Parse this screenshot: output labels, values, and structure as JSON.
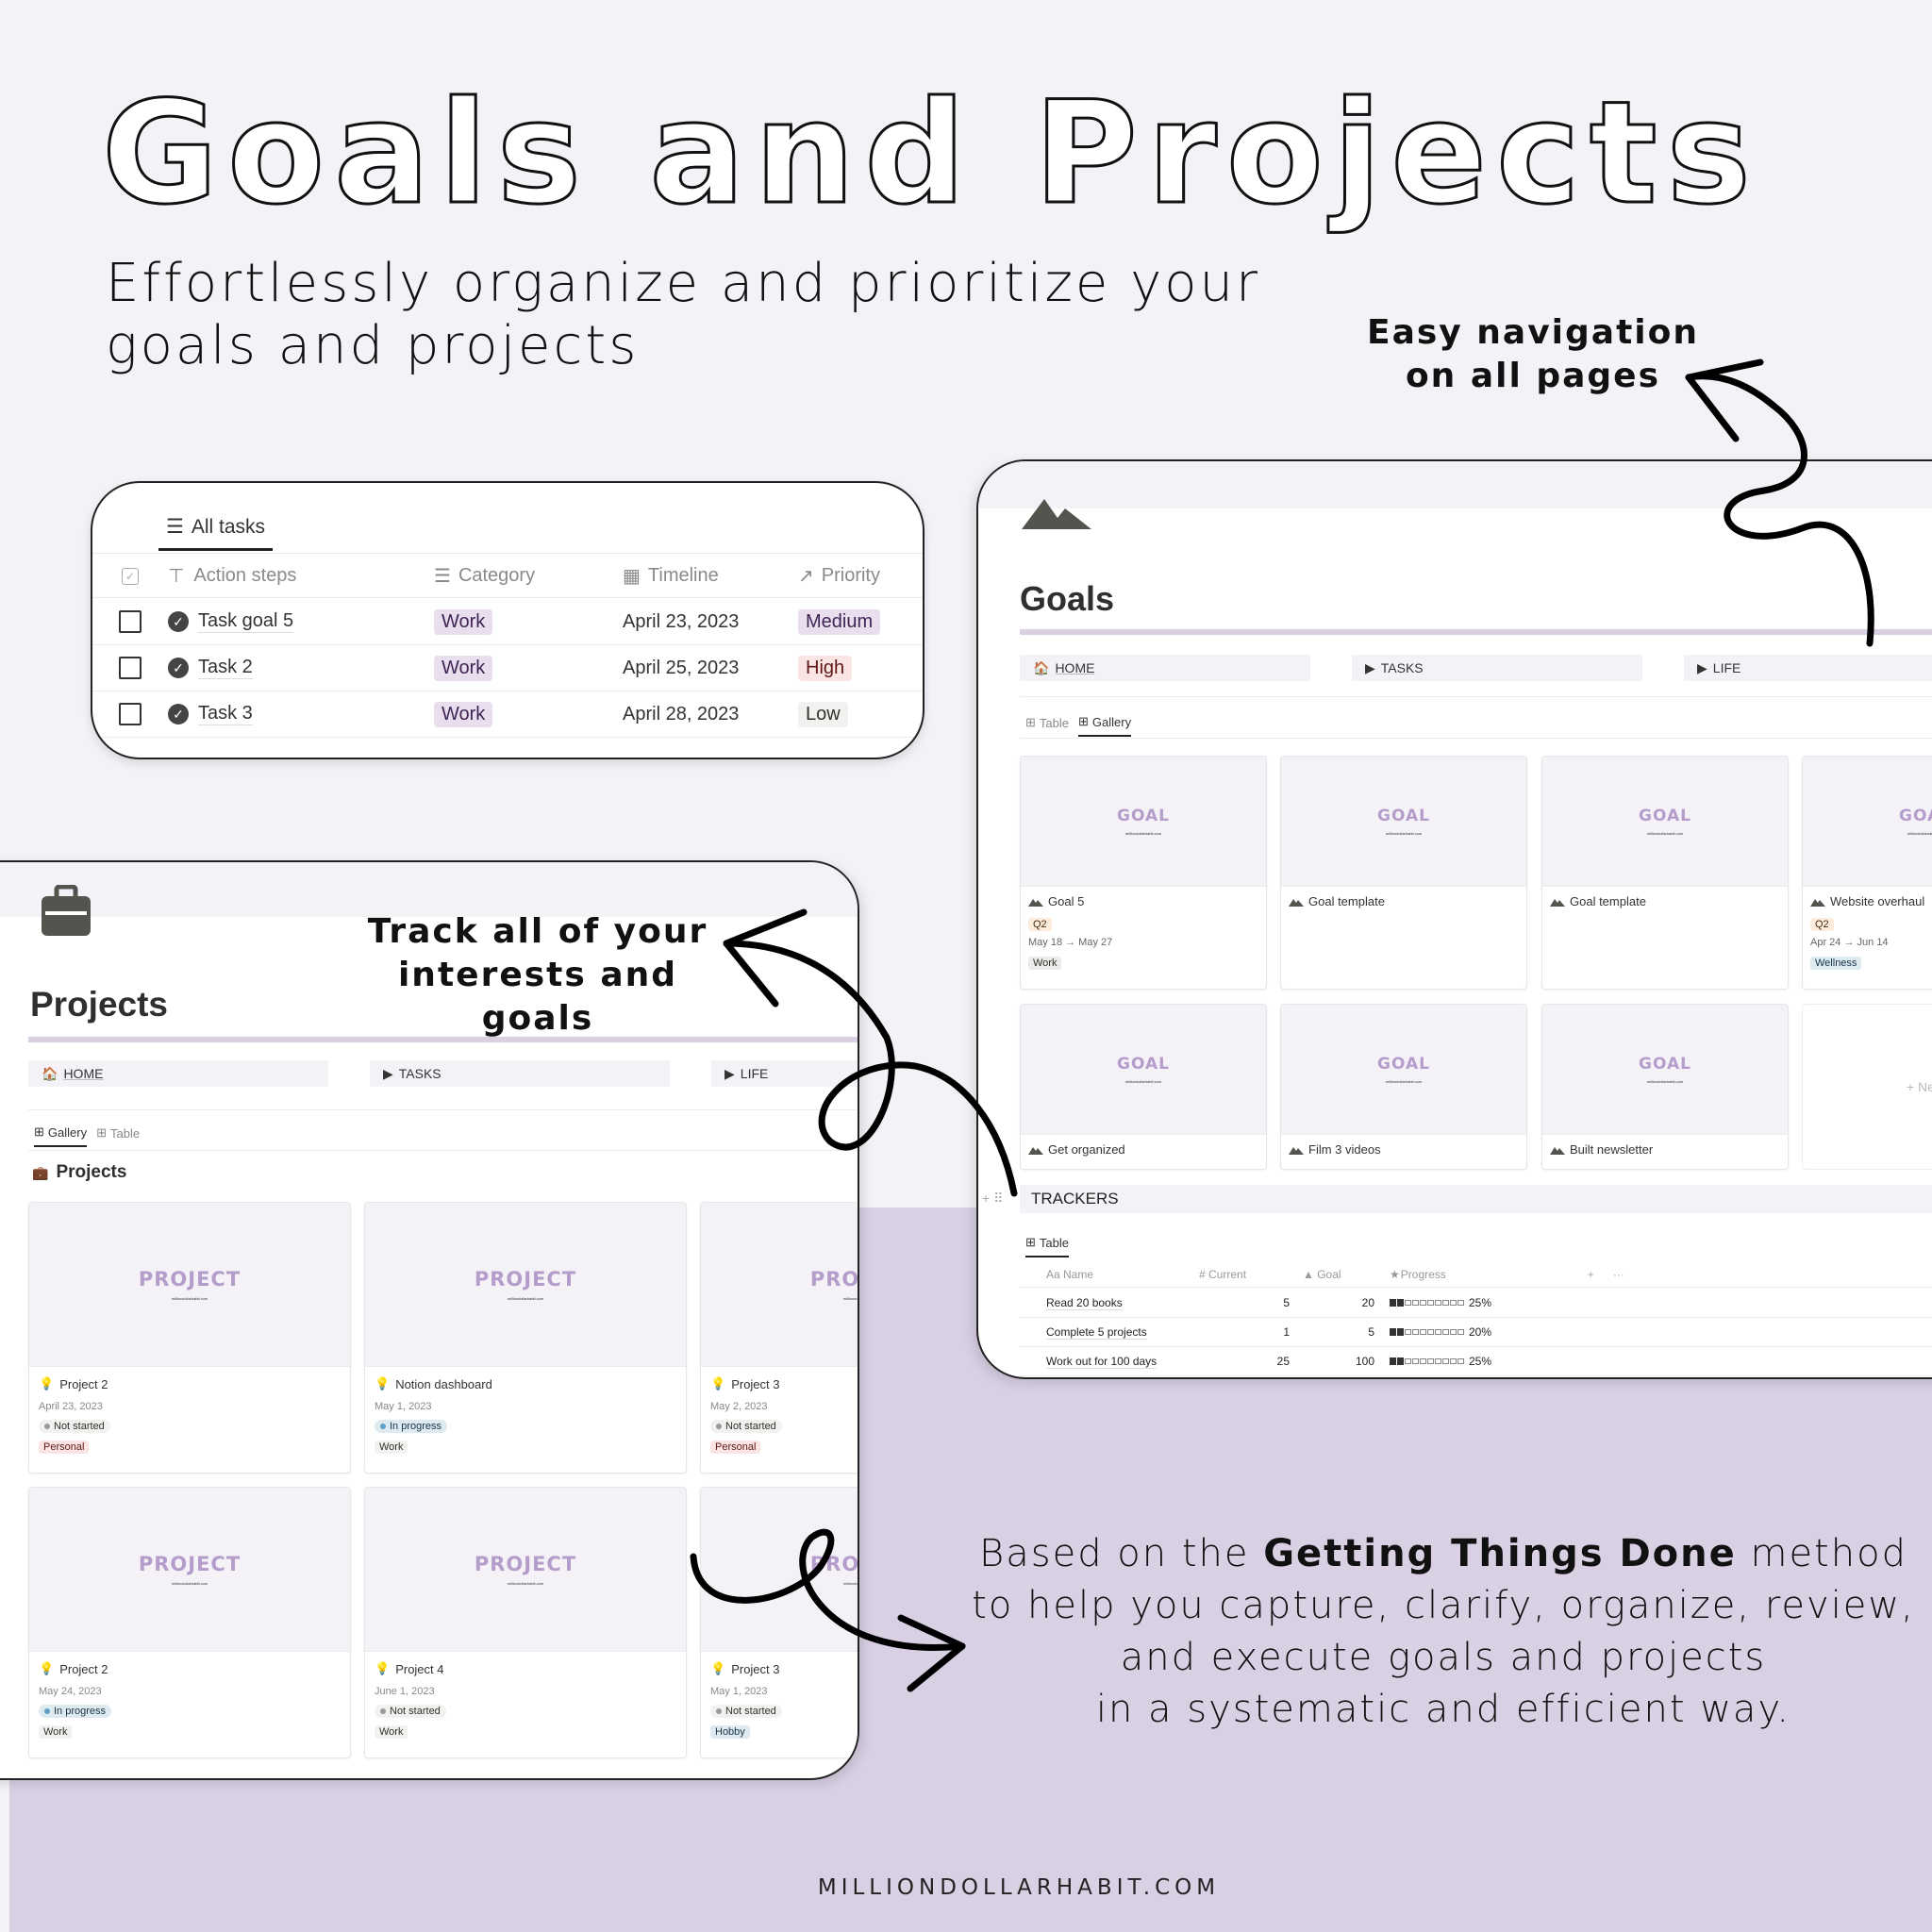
{
  "hero": {
    "title": "Goals and Projects",
    "subtitle": "Effortlessly organize and prioritize your goals and projects"
  },
  "callouts": {
    "navigation_line1": "Easy navigation",
    "navigation_line2": "on all pages",
    "track_line1": "Track all of your",
    "track_line2": "interests and goals",
    "gtd_prefix": "Based on the ",
    "gtd_bold": "Getting Things Done",
    "gtd_suffix": " method",
    "gtd_line2": "to help you capture, clarify, organize, review,",
    "gtd_line3": "and execute goals and projects",
    "gtd_line4": "in a systematic and efficient way."
  },
  "footer": {
    "url": "MILLIONDOLLARHABIT.COM"
  },
  "tasks": {
    "tab_label": "All tasks",
    "columns": [
      "Action steps",
      "Category",
      "Timeline",
      "Priority"
    ],
    "rows": [
      {
        "name": "Task goal 5",
        "category": "Work",
        "timeline": "April 23, 2023",
        "priority": "Medium"
      },
      {
        "name": "Task 2",
        "category": "Work",
        "timeline": "April 25, 2023",
        "priority": "High"
      },
      {
        "name": "Task 3",
        "category": "Work",
        "timeline": "April 28, 2023",
        "priority": "Low"
      }
    ]
  },
  "goals": {
    "title": "Goals",
    "nav": [
      "HOME",
      "TASKS",
      "LIFE"
    ],
    "views": [
      "Table",
      "Gallery"
    ],
    "active_view": "Gallery",
    "cover_word": "GOAL",
    "cover_url": "milliondollarhabit.com",
    "cards": [
      {
        "title": "Goal 5",
        "quarter": "Q2",
        "dates": "May 18 → May 27",
        "tag": "Work"
      },
      {
        "title": "Goal template"
      },
      {
        "title": "Goal template"
      },
      {
        "title": "Website overhaul",
        "quarter": "Q2",
        "dates": "Apr 24 → Jun 14",
        "tag": "Wellness"
      },
      {
        "title": "Get organized"
      },
      {
        "title": "Film 3 videos"
      },
      {
        "title": "Built newsletter"
      }
    ],
    "new_label": "+ New",
    "trackers": {
      "heading": "TRACKERS",
      "view": "Table",
      "columns": [
        "Name",
        "Current",
        "Goal",
        "Progress"
      ],
      "rows": [
        {
          "name": "Read 20 books",
          "current": "5",
          "goal": "20",
          "progress": "25%",
          "filled": 2
        },
        {
          "name": "Complete 5 projects",
          "current": "1",
          "goal": "5",
          "progress": "20%",
          "filled": 2
        },
        {
          "name": "Work out for 100 days",
          "current": "25",
          "goal": "100",
          "progress": "25%",
          "filled": 2
        }
      ]
    }
  },
  "projects": {
    "title": "Projects",
    "nav": [
      "HOME",
      "TASKS",
      "LIFE"
    ],
    "views": [
      "Gallery",
      "Table"
    ],
    "active_view": "Gallery",
    "section_title": "Projects",
    "cover_word": "PROJECT",
    "cover_url": "milliondollarhabit.com",
    "cards": [
      {
        "title": "Project 2",
        "date": "April 23, 2023",
        "status": "Not started",
        "tag": "Personal"
      },
      {
        "title": "Notion dashboard",
        "date": "May 1, 2023",
        "status": "In progress",
        "tag": "Work"
      },
      {
        "title": "Project 3",
        "date": "May 2, 2023",
        "status": "Not started",
        "tag": "Personal"
      },
      {
        "title": "Project 2",
        "date": "May 24, 2023",
        "status": "In progress",
        "tag": "Work"
      },
      {
        "title": "Project 4",
        "date": "June 1, 2023",
        "status": "Not started",
        "tag": "Work"
      },
      {
        "title": "Project 3",
        "date": "May 1, 2023",
        "status": "Not started",
        "tag": "Hobby"
      }
    ]
  },
  "colors": {
    "background": "#f4f2f7",
    "lavender": "#d9d0e4",
    "cover_text": "#b59dcb",
    "icon_dark": "#55534e"
  }
}
